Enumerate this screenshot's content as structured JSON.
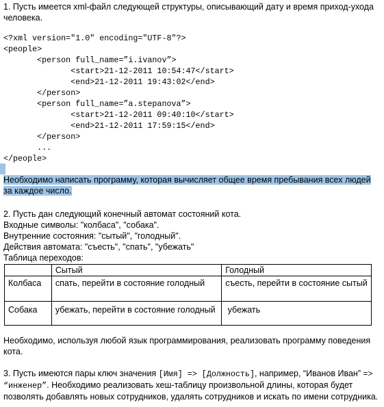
{
  "task1": {
    "intro": "1. Пусть имеется xml-файл следующей структуры, описывающий дату и время приход-ухода человека.",
    "code": [
      "<?xml version=\"1.0\" encoding=\"UTF-8\"?>",
      "<people>",
      "       <person full_name=”i.ivanov”>",
      "              <start>21-12-2011 10:54:47</start>",
      "              <end>21-12-2011 19:43:02</end>",
      "       </person>",
      "       <person full_name=”a.stepanova”>",
      "              <start>21-12-2011 09:40:10</start>",
      "              <end>21-12-2011 17:59:15</end>",
      "       </person>",
      "       ...",
      "</people>"
    ],
    "task_text": "Необходимо написать программу, которая вычисляет общее время пребывания всех людей за каждое число."
  },
  "task2": {
    "intro": "2. Пусть дан следующий конечный автомат состояний кота.",
    "inputs": "Входные символы: \"колбаса\", \"собака\".",
    "states": "Внутренние состояния: \"сытый\", \"голодный\".",
    "actions": "Действия автомата: \"съесть\", \"спать\", \"убежать\"",
    "table_title": "Таблица переходов:",
    "table": {
      "headers": [
        "",
        "Сытый",
        "Голодный"
      ],
      "rows": [
        [
          "Колбаса",
          "спать, перейти в состояние голодный",
          "съесть, перейти в состояние сытый"
        ],
        [
          "Собака",
          "убежать, перейти в состояние голодный",
          " убежать"
        ]
      ]
    },
    "task_text": "Необходимо, используя любой язык программирования, реализовать программу поведения кота."
  },
  "task3": {
    "part1": "3. Пусть имеются пары ключ значения ",
    "code1": "[Имя] => [Должность]",
    "part2": ", например, “Иванов Иван”",
    "code2": "=> “инженер”",
    "part3": ". Необходимо реализовать хеш-таблицу произвольной длины, которая будет позволять добавлять новых сотрудников, удалять сотрудников и искать по имени сотрудника."
  },
  "colors": {
    "selection": "#9ec3e6",
    "text": "#000000",
    "background": "#ffffff"
  }
}
